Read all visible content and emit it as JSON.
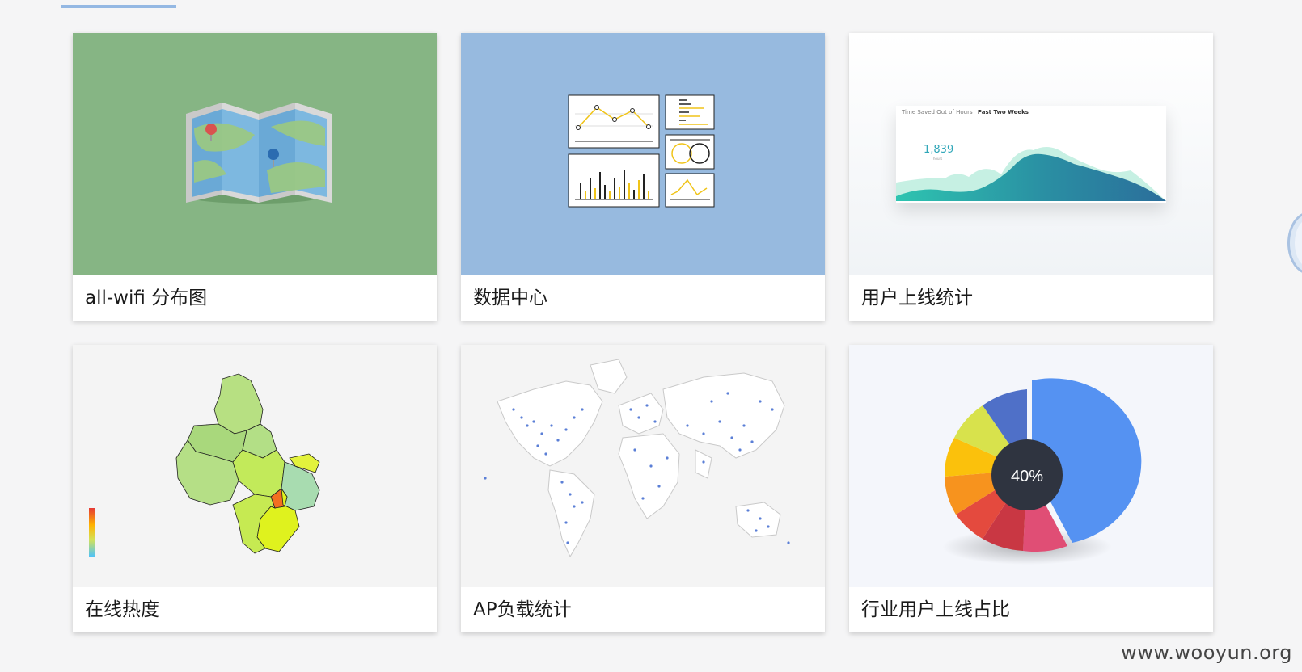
{
  "cards": [
    {
      "title": "all-wifi 分布图",
      "icon": "folded-map-icon",
      "bg": "#86b584"
    },
    {
      "title": "数据中心",
      "icon": "dashboard-charts-icon",
      "bg": "#97badf"
    },
    {
      "title": "用户上线统计",
      "icon": "area-chart-thumbnail",
      "bg": "#f4f6f8",
      "chart_header": "Time Saved Out of Hours",
      "chart_header_bold": "Past Two Weeks",
      "chart_value": "1,839",
      "chart_value_sub": "hours"
    },
    {
      "title": "在线热度",
      "icon": "choropleth-map-thumbnail",
      "bg": "#f4f4f4"
    },
    {
      "title": "AP负载统计",
      "icon": "world-map-thumbnail",
      "bg": "#f4f4f4"
    },
    {
      "title": "行业用户上线占比",
      "icon": "donut-chart-thumbnail",
      "bg": "#f4f6fb",
      "chart_value": "40%"
    }
  ],
  "watermark": "www.wooyun.org"
}
